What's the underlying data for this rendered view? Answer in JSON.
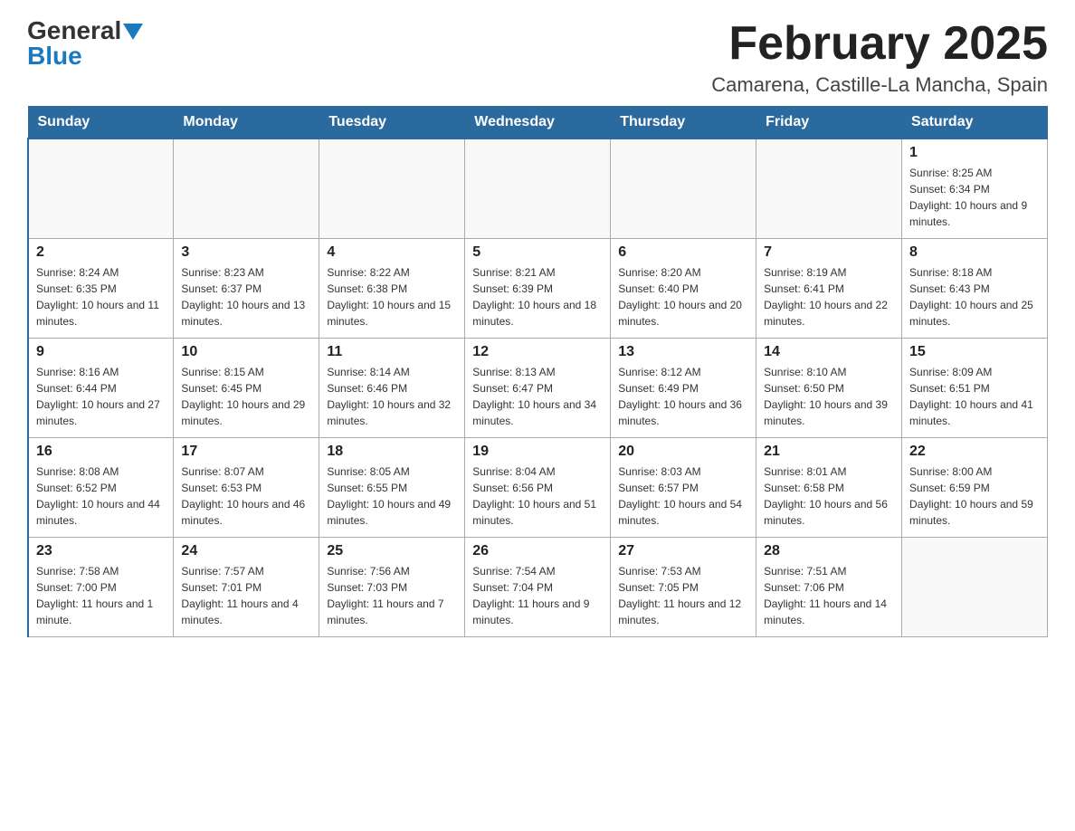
{
  "header": {
    "logo_general": "General",
    "logo_blue": "Blue",
    "title": "February 2025",
    "location": "Camarena, Castille-La Mancha, Spain"
  },
  "days_of_week": [
    "Sunday",
    "Monday",
    "Tuesday",
    "Wednesday",
    "Thursday",
    "Friday",
    "Saturday"
  ],
  "weeks": [
    [
      {
        "day": "",
        "info": ""
      },
      {
        "day": "",
        "info": ""
      },
      {
        "day": "",
        "info": ""
      },
      {
        "day": "",
        "info": ""
      },
      {
        "day": "",
        "info": ""
      },
      {
        "day": "",
        "info": ""
      },
      {
        "day": "1",
        "info": "Sunrise: 8:25 AM\nSunset: 6:34 PM\nDaylight: 10 hours and 9 minutes."
      }
    ],
    [
      {
        "day": "2",
        "info": "Sunrise: 8:24 AM\nSunset: 6:35 PM\nDaylight: 10 hours and 11 minutes."
      },
      {
        "day": "3",
        "info": "Sunrise: 8:23 AM\nSunset: 6:37 PM\nDaylight: 10 hours and 13 minutes."
      },
      {
        "day": "4",
        "info": "Sunrise: 8:22 AM\nSunset: 6:38 PM\nDaylight: 10 hours and 15 minutes."
      },
      {
        "day": "5",
        "info": "Sunrise: 8:21 AM\nSunset: 6:39 PM\nDaylight: 10 hours and 18 minutes."
      },
      {
        "day": "6",
        "info": "Sunrise: 8:20 AM\nSunset: 6:40 PM\nDaylight: 10 hours and 20 minutes."
      },
      {
        "day": "7",
        "info": "Sunrise: 8:19 AM\nSunset: 6:41 PM\nDaylight: 10 hours and 22 minutes."
      },
      {
        "day": "8",
        "info": "Sunrise: 8:18 AM\nSunset: 6:43 PM\nDaylight: 10 hours and 25 minutes."
      }
    ],
    [
      {
        "day": "9",
        "info": "Sunrise: 8:16 AM\nSunset: 6:44 PM\nDaylight: 10 hours and 27 minutes."
      },
      {
        "day": "10",
        "info": "Sunrise: 8:15 AM\nSunset: 6:45 PM\nDaylight: 10 hours and 29 minutes."
      },
      {
        "day": "11",
        "info": "Sunrise: 8:14 AM\nSunset: 6:46 PM\nDaylight: 10 hours and 32 minutes."
      },
      {
        "day": "12",
        "info": "Sunrise: 8:13 AM\nSunset: 6:47 PM\nDaylight: 10 hours and 34 minutes."
      },
      {
        "day": "13",
        "info": "Sunrise: 8:12 AM\nSunset: 6:49 PM\nDaylight: 10 hours and 36 minutes."
      },
      {
        "day": "14",
        "info": "Sunrise: 8:10 AM\nSunset: 6:50 PM\nDaylight: 10 hours and 39 minutes."
      },
      {
        "day": "15",
        "info": "Sunrise: 8:09 AM\nSunset: 6:51 PM\nDaylight: 10 hours and 41 minutes."
      }
    ],
    [
      {
        "day": "16",
        "info": "Sunrise: 8:08 AM\nSunset: 6:52 PM\nDaylight: 10 hours and 44 minutes."
      },
      {
        "day": "17",
        "info": "Sunrise: 8:07 AM\nSunset: 6:53 PM\nDaylight: 10 hours and 46 minutes."
      },
      {
        "day": "18",
        "info": "Sunrise: 8:05 AM\nSunset: 6:55 PM\nDaylight: 10 hours and 49 minutes."
      },
      {
        "day": "19",
        "info": "Sunrise: 8:04 AM\nSunset: 6:56 PM\nDaylight: 10 hours and 51 minutes."
      },
      {
        "day": "20",
        "info": "Sunrise: 8:03 AM\nSunset: 6:57 PM\nDaylight: 10 hours and 54 minutes."
      },
      {
        "day": "21",
        "info": "Sunrise: 8:01 AM\nSunset: 6:58 PM\nDaylight: 10 hours and 56 minutes."
      },
      {
        "day": "22",
        "info": "Sunrise: 8:00 AM\nSunset: 6:59 PM\nDaylight: 10 hours and 59 minutes."
      }
    ],
    [
      {
        "day": "23",
        "info": "Sunrise: 7:58 AM\nSunset: 7:00 PM\nDaylight: 11 hours and 1 minute."
      },
      {
        "day": "24",
        "info": "Sunrise: 7:57 AM\nSunset: 7:01 PM\nDaylight: 11 hours and 4 minutes."
      },
      {
        "day": "25",
        "info": "Sunrise: 7:56 AM\nSunset: 7:03 PM\nDaylight: 11 hours and 7 minutes."
      },
      {
        "day": "26",
        "info": "Sunrise: 7:54 AM\nSunset: 7:04 PM\nDaylight: 11 hours and 9 minutes."
      },
      {
        "day": "27",
        "info": "Sunrise: 7:53 AM\nSunset: 7:05 PM\nDaylight: 11 hours and 12 minutes."
      },
      {
        "day": "28",
        "info": "Sunrise: 7:51 AM\nSunset: 7:06 PM\nDaylight: 11 hours and 14 minutes."
      },
      {
        "day": "",
        "info": ""
      }
    ]
  ]
}
